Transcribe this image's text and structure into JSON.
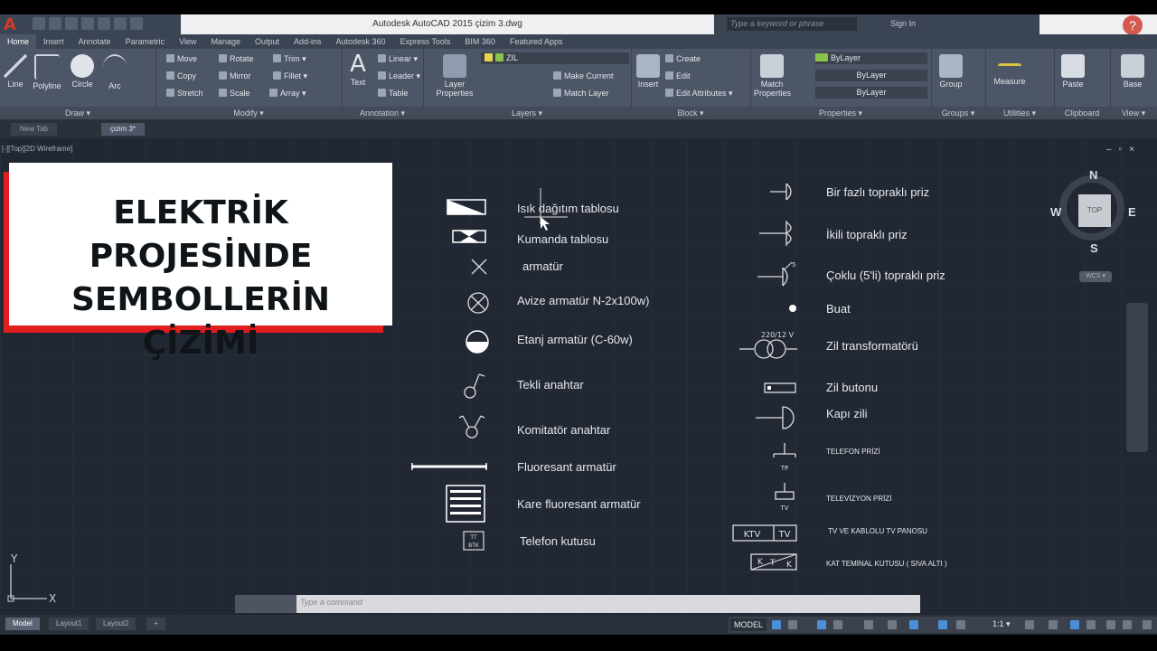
{
  "app": {
    "title": "Autodesk AutoCAD 2015    çizim 3.dwg",
    "search_placeholder": "Type a keyword or phrase",
    "sign_in": "Sign In",
    "help": "?"
  },
  "ribbon_tabs": [
    "Home",
    "Insert",
    "Annotate",
    "Parametric",
    "View",
    "Manage",
    "Output",
    "Add-ins",
    "Autodesk 360",
    "Express Tools",
    "BIM 360",
    "Featured Apps"
  ],
  "ribbon": {
    "draw": {
      "title": "Draw ▾",
      "line": "Line",
      "polyline": "Polyline",
      "circle": "Circle",
      "arc": "Arc"
    },
    "modify": {
      "title": "Modify ▾",
      "move": "Move",
      "rotate": "Rotate",
      "trim": "Trim ▾",
      "copy": "Copy",
      "mirror": "Mirror",
      "fillet": "Fillet ▾",
      "stretch": "Stretch",
      "scale": "Scale",
      "array": "Array ▾"
    },
    "annotation": {
      "title": "Annotation ▾",
      "text": "Text",
      "linear": "Linear ▾",
      "leader": "Leader ▾",
      "table": "Table"
    },
    "layers": {
      "title": "Layers ▾",
      "layer_properties": "Layer Properties",
      "current_layer": "ZIL",
      "make_current": "Make Current",
      "match_layer": "Match Layer"
    },
    "block": {
      "title": "Block ▾",
      "insert": "Insert",
      "create": "Create",
      "edit": "Edit",
      "edit_attributes": "Edit Attributes ▾"
    },
    "properties": {
      "title": "Properties ▾",
      "match_properties": "Match Properties",
      "color": "ByLayer",
      "linetype": "ByLayer",
      "lineweight": "ByLayer"
    },
    "groups": {
      "title": "Groups ▾",
      "group": "Group"
    },
    "utilities": {
      "title": "Utilities ▾",
      "measure": "Measure"
    },
    "clipboard": {
      "title": "Clipboard",
      "paste": "Paste"
    },
    "view": {
      "title": "View ▾",
      "base": "Base"
    }
  },
  "doc_tabs": [
    "New Tab",
    "çizim 3*"
  ],
  "viewport": {
    "label": "[-][Top][2D Wireframe]"
  },
  "banner": {
    "line1": "ELEKTRİK PROJESİNDE",
    "line2": "SEMBOLLERİN ÇİZİMİ"
  },
  "left_symbols": [
    "Isık dağıtım tablosu",
    "Kumanda tablosu",
    "armatür",
    "Avize armatür N-2x100w)",
    "Etanj armatür (C-60w)",
    "Tekli anahtar",
    "Komitatör anahtar",
    "Fluoresant  armatür",
    "Kare fluoresant armatür",
    "Telefon kutusu"
  ],
  "right_symbols": [
    "Bir fazlı topraklı priz",
    "İkili topraklı priz",
    "Çoklu (5'li) topraklı priz",
    "Buat",
    "Zil transformatörü",
    "Zil butonu",
    "Kapı zili",
    "TELEFON PRİZİ",
    "TELEVİZYON PRİZİ",
    "TV VE KABLOLU TV PANOSU",
    "KAT TEMİNAL KUTUSU ( SIVA ALTI )"
  ],
  "symbol_texts": {
    "transformer": "220/12 V",
    "socket_count": "5",
    "tp": "TP",
    "tv": "TV",
    "ktv": "KTV",
    "tv2": "TV",
    "k": "K",
    "t": "T",
    "k2": "K",
    "tel1": "TT",
    "tel2": "BTK"
  },
  "compass": {
    "n": "N",
    "s": "S",
    "e": "E",
    "w": "W",
    "top": "TOP",
    "wcs": "WCS ▾"
  },
  "ucs": {
    "x": "X",
    "y": "Y"
  },
  "command_line": {
    "placeholder": "Type  a  command"
  },
  "layout_tabs": [
    "Model",
    "Layout1",
    "Layout2",
    "+"
  ],
  "status": {
    "model": "MODEL",
    "scale": "1:1 ▾"
  }
}
